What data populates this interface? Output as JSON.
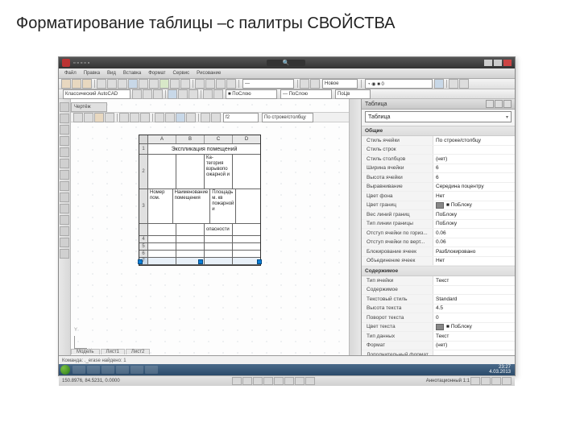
{
  "caption": "Форматирование таблицы –с палитры СВОЙСТВА",
  "menu": [
    "Файл",
    "Правка",
    "Вид",
    "Вставка",
    "Формат",
    "Сервис",
    "Рисование"
  ],
  "toolbar": {
    "scale": "—",
    "layerstate": "Новое",
    "layer": "◔ ◉ ■ 0",
    "linetype": "Классический AutoCAD",
    "color": "■ ПоСлою",
    "lineweight": "— ПоСлою",
    "plot": "ПоЦв"
  },
  "canvas": {
    "filetab": "Чертёж",
    "cellformat": "f2",
    "cellstyle": "По строке/столбцу",
    "tabs": [
      "Модель",
      "Лист1",
      "Лист2"
    ]
  },
  "table": {
    "cols": [
      "A",
      "B",
      "C",
      "D"
    ],
    "rows": [
      {
        "n": "1",
        "title": "Экспликация помещений"
      },
      {
        "n": "2",
        "a": "",
        "b": "",
        "c1": "Ка-",
        "c2": "тегория",
        "c3": "взрывопо",
        "c4": "ожарной и"
      },
      {
        "n": "3",
        "a1": "Номер",
        "a2": "пом.",
        "b1": "Наименование",
        "b2": "помещения",
        "c1": "Площадь",
        "c2": "м. кв",
        "c3": "пожарной",
        "c4": "и"
      },
      {
        "n": "",
        "c": "опасности"
      },
      {
        "n": "4"
      },
      {
        "n": "5"
      },
      {
        "n": "6"
      },
      {
        "n": "7"
      }
    ]
  },
  "props": {
    "title": "Таблица",
    "selection": "Таблица",
    "groups": [
      {
        "name": "Общие",
        "rows": [
          {
            "k": "Стиль ячейки",
            "v": "По строке/столбцу"
          },
          {
            "k": "Стиль строк",
            "v": ""
          },
          {
            "k": "Стиль столбцов",
            "v": "(нет)"
          },
          {
            "k": "Ширина ячейки",
            "v": "6"
          },
          {
            "k": "Высота ячейки",
            "v": "6"
          },
          {
            "k": "Выравнивание",
            "v": "Середина поцентру"
          },
          {
            "k": "Цвет фона",
            "v": "Нет"
          },
          {
            "k": "Цвет границ",
            "v": "■ ПоБлоку",
            "sw": "#888"
          },
          {
            "k": "Вес линий границ",
            "v": "ПоБлоку"
          },
          {
            "k": "Тип линии границы",
            "v": "ПоБлоку"
          },
          {
            "k": "Отступ ячейки по гориз...",
            "v": "0.06"
          },
          {
            "k": "Отступ ячейки по верт...",
            "v": "0.06"
          },
          {
            "k": "Блокирование ячеек",
            "v": "Разблокировано"
          },
          {
            "k": "Объединение ячеек",
            "v": "Нет"
          }
        ]
      },
      {
        "name": "Содержимое",
        "rows": [
          {
            "k": "Тип ячейки",
            "v": "Текст"
          },
          {
            "k": "Содержимое",
            "v": ""
          },
          {
            "k": "Текстовый стиль",
            "v": "Standard"
          },
          {
            "k": "Высота текста",
            "v": "4.5"
          },
          {
            "k": "Поворот текста",
            "v": "0"
          },
          {
            "k": "Цвет текста",
            "v": "■ ПоБлоку",
            "sw": "#888"
          },
          {
            "k": "Тип данных",
            "v": "Текст"
          },
          {
            "k": "Формат",
            "v": "(нет)"
          },
          {
            "k": "Дополнительный формат",
            "v": ""
          }
        ]
      },
      {
        "name": "",
        "rows": []
      }
    ]
  },
  "cmdline": [
    "Команда: ._erase найдено: 1",
    "Команда:"
  ],
  "status": {
    "coords": "150.8976, 84.5231, 0.0000",
    "right": "Аннотационный 1:1"
  },
  "taskbar": {
    "time": "23:27",
    "date": "4.03.2013"
  }
}
